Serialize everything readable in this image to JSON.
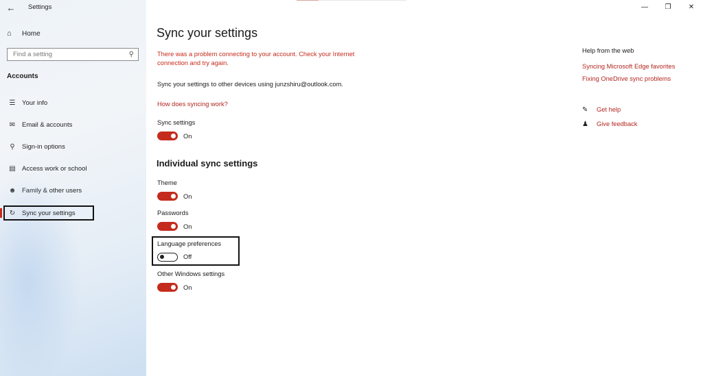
{
  "window": {
    "title": "Settings",
    "controls": {
      "minimize": "—",
      "restore": "❐",
      "close": "✕"
    }
  },
  "sidebar": {
    "home_label": "Home",
    "search_placeholder": "Find a setting",
    "section": "Accounts",
    "items": [
      {
        "label": "Your info",
        "icon": "person-card-icon"
      },
      {
        "label": "Email & accounts",
        "icon": "mail-icon"
      },
      {
        "label": "Sign-in options",
        "icon": "key-icon"
      },
      {
        "label": "Access work or school",
        "icon": "briefcase-icon"
      },
      {
        "label": "Family & other users",
        "icon": "person-add-icon"
      },
      {
        "label": "Sync your settings",
        "icon": "sync-icon",
        "selected": true
      }
    ]
  },
  "main": {
    "title": "Sync your settings",
    "error": "There was a problem connecting to your account. Check your Internet connection and try again.",
    "description": "Sync your settings to other devices using junzshiru@outlook.com.",
    "how_link": "How does syncing work?",
    "sync_settings": {
      "label": "Sync settings",
      "state": "On"
    },
    "individual_heading": "Individual sync settings",
    "individual": [
      {
        "label": "Theme",
        "state": "On"
      },
      {
        "label": "Passwords",
        "state": "On"
      },
      {
        "label": "Language preferences",
        "state": "Off"
      },
      {
        "label": "Other Windows settings",
        "state": "On"
      }
    ]
  },
  "help": {
    "heading": "Help from the web",
    "links": [
      "Syncing Microsoft Edge favorites",
      "Fixing OneDrive sync problems"
    ],
    "get_help": "Get help",
    "give_feedback": "Give feedback"
  },
  "colors": {
    "accent": "#c42b1c",
    "link": "#b3261e",
    "error": "#c42b1c"
  }
}
